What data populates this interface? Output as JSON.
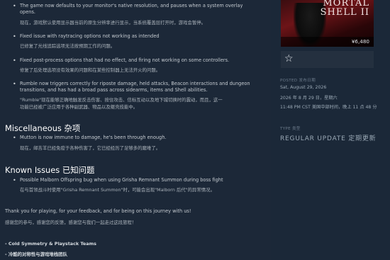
{
  "notes": {
    "bullets": [
      {
        "en": [
          "The game now defaults to your monitor's native resolution, and pauses when a system overlay",
          "opens."
        ],
        "zh": [
          "现在，游戏默认使用显示器当前的原生分辨率进行显示，当系统覆盖层打开时，游戏会暂停。"
        ]
      },
      {
        "en": [
          "Fixed issue with raytracing options not working as intended"
        ],
        "zh": [
          "已修复了光线追踪选项无法按预期工作的问题。"
        ]
      },
      {
        "en": [
          "Fixed post-process options that had no effect, and firing not working on some controllers."
        ],
        "zh": [
          "修复了后处理选项没有效果的问题和在某些控制器上无法开火的问题。"
        ]
      },
      {
        "en": [
          "Rumble now triggers correctly for riposte damage, held attacks, Beacon interactions and dungeon",
          "transitions, and has had a broad pass across sidearms, items and Shell abilities."
        ],
        "zh": [
          "\"Rumble\"现在能够正确地触发反击伤害、按住攻击、信标互动以及地下城切换时的震动，而且，这一",
          "功能已经被广泛应用于各种副武器、物品以及躯壳技能中。"
        ]
      }
    ],
    "misc_heading": "Miscellaneous  杂项",
    "misc_bullets": [
      {
        "en": [
          "Mutton is now immune to damage, he's been through enough."
        ],
        "zh": [
          "现在，邮吉羊已经免疫于各种伤害了，它已经经历了足够多的磨难了。"
        ]
      }
    ],
    "known_heading": "Known Issues  已知问题",
    "known_bullets": [
      {
        "en": [
          "Possible Malborn Offspring bug when using Grisha Remnant Summon during boss fight"
        ],
        "zh": [
          "在与首领战斗时使用\"Grisha Remnant Summon\"时，可能会出现\"Malborn 后代\"的异常情况。"
        ]
      }
    ],
    "thanks_en": "Thank you for playing, for your feedback, and for being on this journey with us!",
    "thanks_zh": "感谢您的参与，感谢您的反馈，感谢您与我们一起走过这段旅程！",
    "credit_en": "- Cold Symmetry & Playstack Teams",
    "credit_zh": "- 冷酷的对称性与游戏堆栈团队"
  },
  "sidebar": {
    "logo_line1": "MORTAL",
    "logo_line2": "SHELL II",
    "price": "¥6,480",
    "wishlist_icon": "star-outline-icon",
    "posted_label": "POSTED  发布日期",
    "posted_en": "Sat, August 29, 2026",
    "posted_zh": "2026 年 8 月 29 日，星期六",
    "posted_time": "11:48 PM CST  美国中部时间，晚上 11 点 48 分",
    "type_label": "TYPE  类型",
    "type_value": "REGULAR UPDATE  定期更新"
  },
  "colors": {
    "background": "#1b2838",
    "heading": "#ffffff",
    "text": "#c4cad0",
    "muted": "#6b7a8a"
  }
}
